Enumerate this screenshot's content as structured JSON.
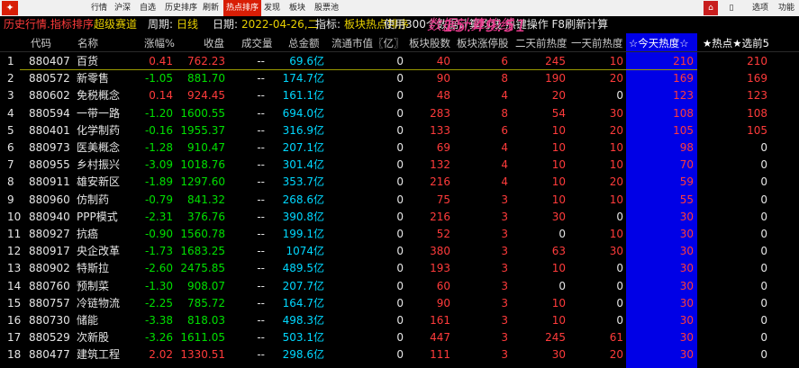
{
  "menubar": {
    "items": [
      "行情",
      "沪深",
      "自选",
      "历史排序",
      "刷新",
      "热点排序",
      "发现",
      "板块",
      "股票池"
    ],
    "active_index": 5,
    "right": {
      "red_icon": "⌂",
      "options": "选项",
      "function": "功能",
      "minimize": "—",
      "restore": "□",
      "close": "×"
    }
  },
  "info": {
    "title": "历史行情.指标排序",
    "tag": "超级赛道",
    "period_label": "周期:",
    "period_value": "日线",
    "date_label": "日期:",
    "date_value": "2022-04-26,二",
    "indicator_label": "指标:",
    "indicator_value": "板块热点排序",
    "note": "使用300个数据计算均线 热键操作 F8刷新计算",
    "clock": "15:49:51",
    "clock_sub": "数据计算均线"
  },
  "table": {
    "headers": [
      "代码",
      "名称",
      "涨幅%",
      "收盘",
      "成交量",
      "总金额",
      "流通市值〖亿〗",
      "板块股数",
      "板块涨停股",
      "二天前热度",
      "一天前热度",
      "☆今天热度☆",
      "★热点★选前5"
    ],
    "rows": [
      [
        "1",
        "880407",
        "百货",
        "0.41",
        "762.23",
        "--",
        "69.6亿",
        "0",
        "40",
        "6",
        "245",
        "10",
        "210",
        "210"
      ],
      [
        "2",
        "880572",
        "新零售",
        "-1.05",
        "881.70",
        "--",
        "174.7亿",
        "0",
        "90",
        "8",
        "190",
        "20",
        "169",
        "169"
      ],
      [
        "3",
        "880602",
        "免税概念",
        "0.14",
        "924.45",
        "--",
        "161.1亿",
        "0",
        "48",
        "4",
        "20",
        "0",
        "123",
        "123"
      ],
      [
        "4",
        "880594",
        "一带一路",
        "-1.20",
        "1600.55",
        "--",
        "694.0亿",
        "0",
        "283",
        "8",
        "54",
        "30",
        "108",
        "108"
      ],
      [
        "5",
        "880401",
        "化学制药",
        "-0.16",
        "1955.37",
        "--",
        "316.9亿",
        "0",
        "133",
        "6",
        "10",
        "20",
        "105",
        "105"
      ],
      [
        "6",
        "880973",
        "医美概念",
        "-1.28",
        "910.47",
        "--",
        "207.1亿",
        "0",
        "69",
        "4",
        "10",
        "10",
        "98",
        "0"
      ],
      [
        "7",
        "880955",
        "乡村振兴",
        "-3.09",
        "1018.76",
        "--",
        "301.4亿",
        "0",
        "132",
        "4",
        "10",
        "10",
        "70",
        "0"
      ],
      [
        "8",
        "880911",
        "雄安新区",
        "-1.89",
        "1297.60",
        "--",
        "353.7亿",
        "0",
        "216",
        "4",
        "10",
        "20",
        "59",
        "0"
      ],
      [
        "9",
        "880960",
        "仿制药",
        "-0.79",
        "841.32",
        "--",
        "268.6亿",
        "0",
        "75",
        "3",
        "10",
        "10",
        "55",
        "0"
      ],
      [
        "10",
        "880940",
        "PPP模式",
        "-2.31",
        "376.76",
        "--",
        "390.8亿",
        "0",
        "216",
        "3",
        "30",
        "0",
        "30",
        "0"
      ],
      [
        "11",
        "880927",
        "抗癌",
        "-0.90",
        "1560.78",
        "--",
        "199.1亿",
        "0",
        "52",
        "3",
        "0",
        "10",
        "30",
        "0"
      ],
      [
        "12",
        "880917",
        "央企改革",
        "-1.73",
        "1683.25",
        "--",
        "1074亿",
        "0",
        "380",
        "3",
        "63",
        "30",
        "30",
        "0"
      ],
      [
        "13",
        "880902",
        "特斯拉",
        "-2.60",
        "2475.85",
        "--",
        "489.5亿",
        "0",
        "193",
        "3",
        "10",
        "0",
        "30",
        "0"
      ],
      [
        "14",
        "880760",
        "预制菜",
        "-1.30",
        "908.07",
        "--",
        "207.7亿",
        "0",
        "60",
        "3",
        "0",
        "0",
        "30",
        "0"
      ],
      [
        "15",
        "880757",
        "冷链物流",
        "-2.25",
        "785.72",
        "--",
        "164.7亿",
        "0",
        "90",
        "3",
        "10",
        "0",
        "30",
        "0"
      ],
      [
        "16",
        "880730",
        "储能",
        "-3.38",
        "818.03",
        "--",
        "498.3亿",
        "0",
        "161",
        "3",
        "10",
        "0",
        "30",
        "0"
      ],
      [
        "17",
        "880529",
        "次新股",
        "-3.26",
        "1611.05",
        "--",
        "503.1亿",
        "0",
        "447",
        "3",
        "245",
        "61",
        "30",
        "0"
      ],
      [
        "18",
        "880477",
        "建筑工程",
        "2.02",
        "1330.51",
        "--",
        "298.6亿",
        "0",
        "111",
        "3",
        "30",
        "20",
        "30",
        "0"
      ]
    ]
  },
  "colors": {
    "red": "#ff3b3b",
    "green": "#00e000",
    "white": "#e6e6e6",
    "cyan": "#00d8ff",
    "yellow": "#e8d000",
    "blue_col": "#0000e6",
    "accent": "#d81e06"
  }
}
